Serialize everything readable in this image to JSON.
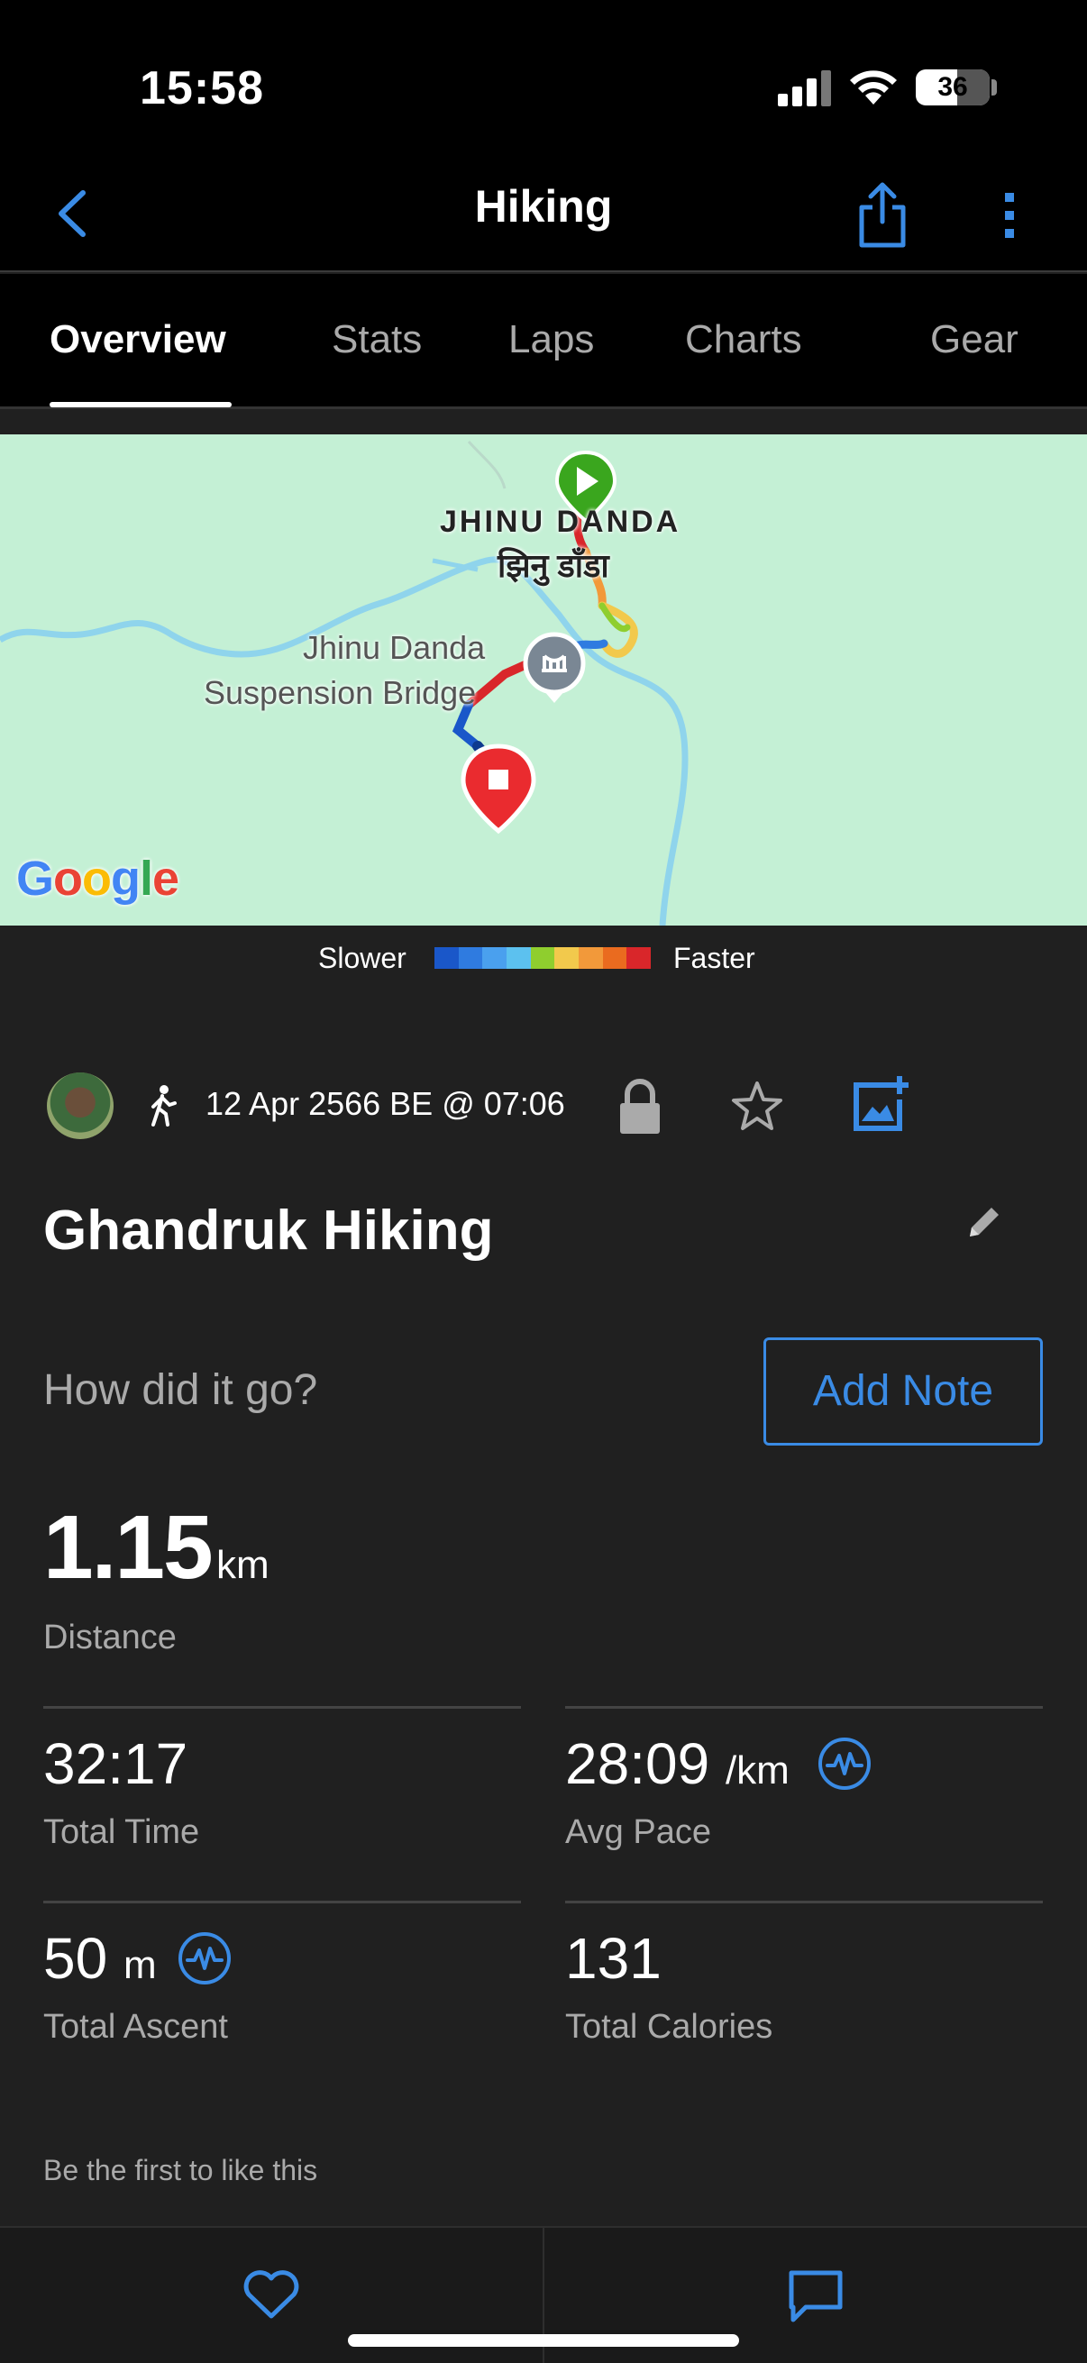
{
  "status_bar": {
    "time": "15:58",
    "battery": "36"
  },
  "nav": {
    "title": "Hiking"
  },
  "tabs": [
    {
      "label": "Overview"
    },
    {
      "label": "Stats"
    },
    {
      "label": "Laps"
    },
    {
      "label": "Charts"
    },
    {
      "label": "Gear"
    }
  ],
  "map": {
    "town_name": "JHINU DANDA",
    "town_name_np": "झिनु डाँडा",
    "poi_line1": "Jhinu Danda",
    "poi_line2": "Suspension Bridge",
    "attribution": "Google"
  },
  "legend": {
    "slower": "Slower",
    "faster": "Faster",
    "colors": [
      "#1a57c9",
      "#2f7be0",
      "#4aa0ee",
      "#5cc1ef",
      "#8fce2e",
      "#f2c94c",
      "#f2993a",
      "#ea6b1f",
      "#d9262a"
    ]
  },
  "activity": {
    "date": "12 Apr 2566 BE @ 07:06",
    "title": "Ghandruk Hiking",
    "note_prompt": "How did it go?",
    "add_note_label": "Add Note"
  },
  "stats": {
    "distance": {
      "value": "1.15",
      "unit": "km",
      "label": "Distance"
    },
    "total_time": {
      "value": "32:17",
      "label": "Total Time"
    },
    "avg_pace": {
      "value": "28:09",
      "unit": "/km",
      "label": "Avg Pace"
    },
    "total_ascent": {
      "value": "50",
      "unit": "m",
      "label": "Total Ascent"
    },
    "total_calories": {
      "value": "131",
      "label": "Total Calories"
    }
  },
  "social": {
    "like_text": "Be the first to like this"
  },
  "colors": {
    "accent": "#3a8be5",
    "background": "#202020",
    "map_bg": "#c4f0d5"
  }
}
